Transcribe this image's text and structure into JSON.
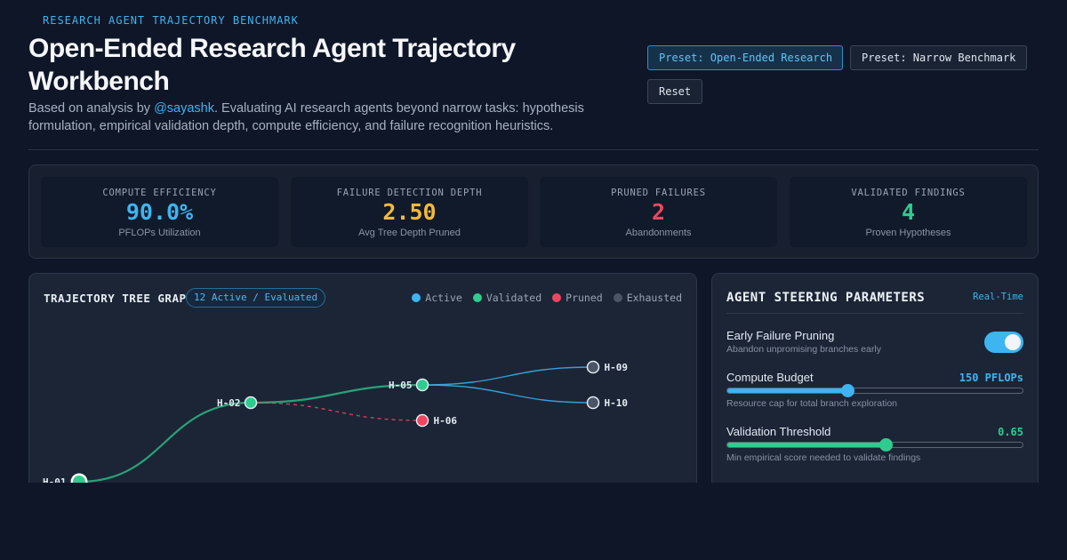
{
  "header": {
    "eyebrow": "RESEARCH AGENT TRAJECTORY BENCHMARK",
    "title": "Open-Ended Research Agent Trajectory Workbench",
    "subtitle_prefix": "Based on analysis by ",
    "subtitle_handle": "@sayashk",
    "subtitle_suffix": ". Evaluating AI research agents beyond narrow tasks: hypothesis formulation, empirical validation depth, compute efficiency, and failure recognition heuristics."
  },
  "toolbar": {
    "preset_open_label": "Preset: Open-Ended Research",
    "preset_narrow_label": "Preset: Narrow Benchmark",
    "reset_label": "Reset",
    "active_preset": "open"
  },
  "metrics": [
    {
      "label": "COMPUTE EFFICIENCY",
      "value": "90.0%",
      "sub": "PFLOPs Utilization",
      "color": "#3db5f0"
    },
    {
      "label": "FAILURE DETECTION DEPTH",
      "value": "2.50",
      "sub": "Avg Tree Depth Pruned",
      "color": "#f5b93a"
    },
    {
      "label": "PRUNED FAILURES",
      "value": "2",
      "sub": "Abandonments",
      "color": "#f0455f"
    },
    {
      "label": "VALIDATED FINDINGS",
      "value": "4",
      "sub": "Proven Hypotheses",
      "color": "#2fcc8f"
    }
  ],
  "graph": {
    "title": "TRAJECTORY TREE GRAPH",
    "badge": "12 Active / Evaluated",
    "legend": [
      {
        "label": "Active",
        "color": "#3db5f0"
      },
      {
        "label": "Validated",
        "color": "#2fcc8f"
      },
      {
        "label": "Pruned",
        "color": "#f0455f"
      },
      {
        "label": "Exhausted",
        "color": "#4b5566"
      }
    ],
    "nodes": [
      {
        "id": "H-01",
        "status": "validated",
        "root": true
      },
      {
        "id": "H-02",
        "status": "validated"
      },
      {
        "id": "H-05",
        "status": "validated"
      },
      {
        "id": "H-06",
        "status": "pruned"
      },
      {
        "id": "H-09",
        "status": "exhausted"
      },
      {
        "id": "H-10",
        "status": "exhausted"
      }
    ],
    "edges": [
      {
        "from": "H-01",
        "to": "H-02",
        "status": "validated"
      },
      {
        "from": "H-02",
        "to": "H-05",
        "status": "validated"
      },
      {
        "from": "H-02",
        "to": "H-06",
        "status": "pruned"
      },
      {
        "from": "H-05",
        "to": "H-09",
        "status": "active"
      },
      {
        "from": "H-05",
        "to": "H-10",
        "status": "active"
      }
    ]
  },
  "steering": {
    "title": "AGENT STEERING PARAMETERS",
    "realtime": "Real-Time",
    "early_pruning": {
      "label": "Early Failure Pruning",
      "help": "Abandon unpromising branches early",
      "enabled": true
    },
    "compute_budget": {
      "label": "Compute Budget",
      "value_text": "150 PFLOPs",
      "help": "Resource cap for total branch exploration",
      "fraction": 0.41,
      "color": "#3db5f0"
    },
    "validation_threshold": {
      "label": "Validation Threshold",
      "value_text": "0.65",
      "help": "Min empirical score needed to validate findings",
      "fraction": 0.54,
      "color": "#2fcc8f"
    }
  }
}
